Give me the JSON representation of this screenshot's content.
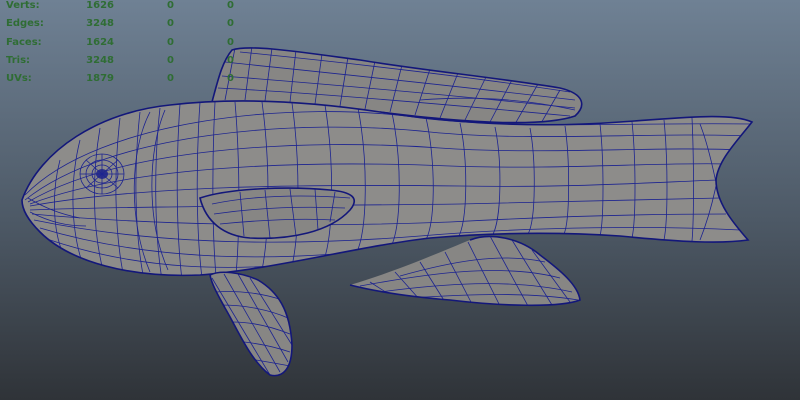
{
  "hud": {
    "rows": [
      {
        "label": "Verts:",
        "v1": "1626",
        "v2": "0",
        "v3": "0"
      },
      {
        "label": "Edges:",
        "v1": "3248",
        "v2": "0",
        "v3": "0"
      },
      {
        "label": "Faces:",
        "v1": "1624",
        "v2": "0",
        "v3": "0"
      },
      {
        "label": "Tris:",
        "v1": "3248",
        "v2": "0",
        "v3": "0"
      },
      {
        "label": "UVs:",
        "v1": "1879",
        "v2": "0",
        "v3": "0"
      }
    ],
    "text_color": "#2f6d34"
  },
  "viewport": {
    "background_top": "#6f8194",
    "background_bottom": "#2f3338",
    "model": "fish-mesh",
    "wire_color": "#1c2390",
    "shade_color": "#8d8c8a"
  }
}
